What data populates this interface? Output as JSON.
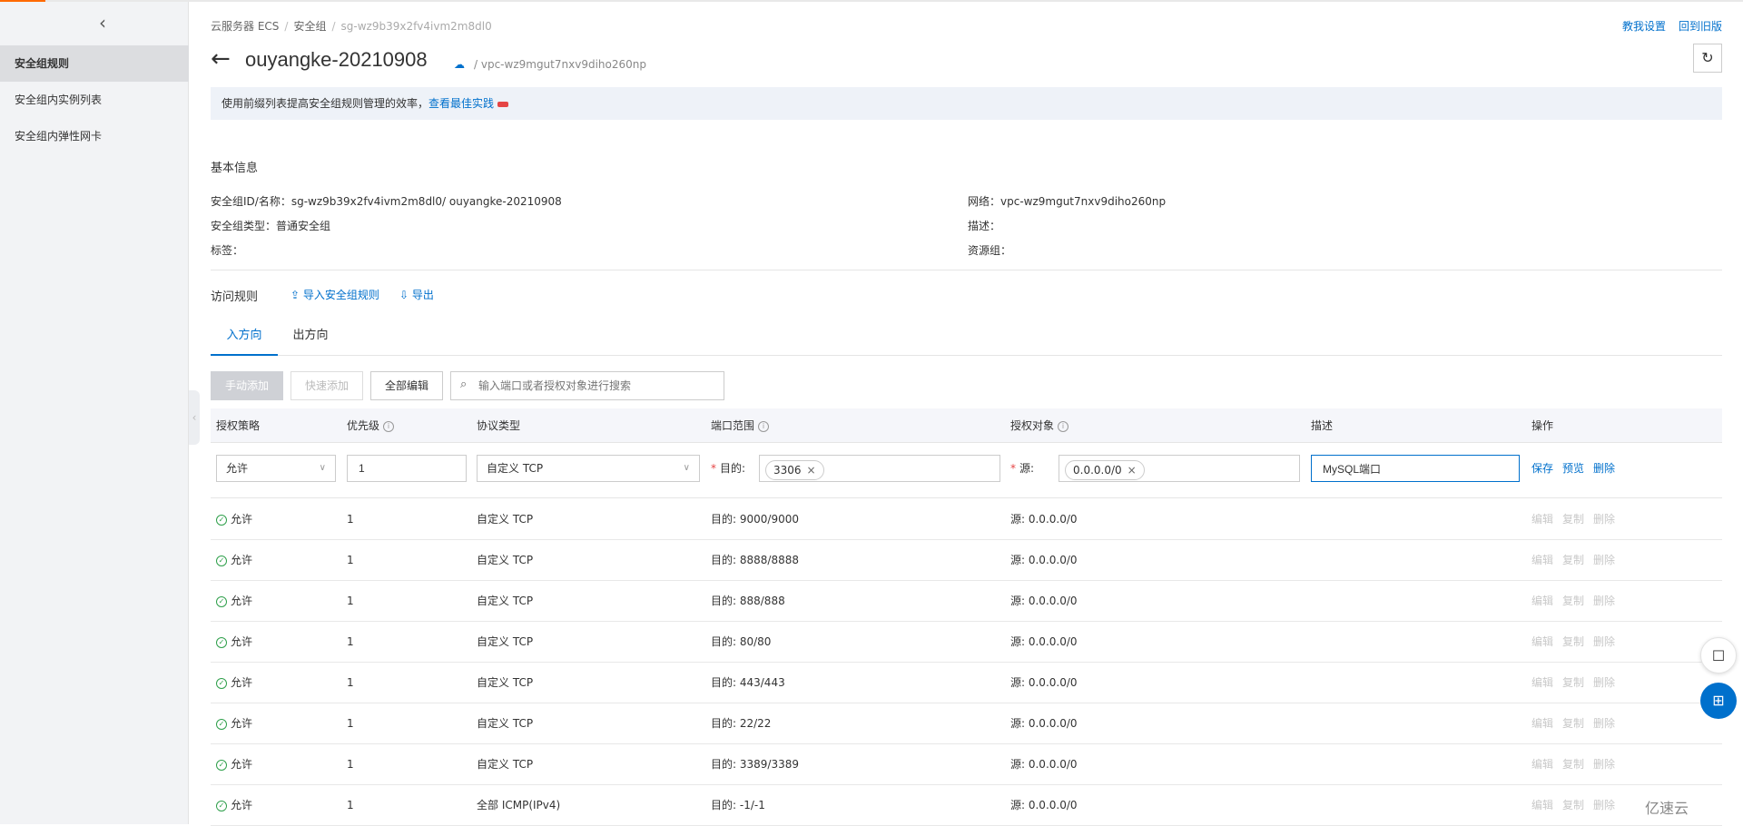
{
  "sidebar": {
    "items": [
      "安全组规则",
      "安全组内实例列表",
      "安全组内弹性网卡"
    ]
  },
  "breadcrumb": [
    "云服务器 ECS",
    "安全组",
    "sg-wz9b39x2fv4ivm2m8dl0"
  ],
  "top_links": {
    "feedback": "教我设置",
    "old_version": "回到旧版"
  },
  "header": {
    "title": "ouyangke-20210908",
    "vpc": "/ vpc-wz9mgut7nxv9diho260np"
  },
  "tip": {
    "text": "使用前缀列表提高安全组规则管理的效率，",
    "link": "查看最佳实践"
  },
  "basic_info": {
    "title": "基本信息",
    "id_name": "安全组ID/名称：sg-wz9b39x2fv4ivm2m8dl0/ ouyangke-20210908",
    "type": "安全组类型：普通安全组",
    "tags": "标签：",
    "network": "网络：vpc-wz9mgut7nxv9diho260np",
    "desc": "描述：",
    "resource_group": "资源组："
  },
  "rules": {
    "title": "访问规则",
    "import": "导入安全组规则",
    "export": "导出",
    "tabs": [
      "入方向",
      "出方向"
    ],
    "buttons": {
      "manual_add": "手动添加",
      "quick_add": "快速添加",
      "edit_all": "全部编辑"
    },
    "search_placeholder": "输入端口或者授权对象进行搜索",
    "columns": [
      "授权策略",
      "优先级",
      "协议类型",
      "端口范围",
      "授权对象",
      "描述",
      "操作"
    ],
    "edit_row": {
      "policy": "允许",
      "priority": "1",
      "protocol": "自定义 TCP",
      "dest_label": "目的:",
      "port_chip": "3306",
      "src_label": "源:",
      "src_chip": "0.0.0.0/0",
      "description": "MySQL端口",
      "actions": [
        "保存",
        "预览",
        "删除"
      ]
    },
    "rows": [
      {
        "policy": "允许",
        "priority": "1",
        "protocol": "自定义 TCP",
        "port": "目的: 9000/9000",
        "source": "源: 0.0.0.0/0"
      },
      {
        "policy": "允许",
        "priority": "1",
        "protocol": "自定义 TCP",
        "port": "目的: 8888/8888",
        "source": "源: 0.0.0.0/0"
      },
      {
        "policy": "允许",
        "priority": "1",
        "protocol": "自定义 TCP",
        "port": "目的: 888/888",
        "source": "源: 0.0.0.0/0"
      },
      {
        "policy": "允许",
        "priority": "1",
        "protocol": "自定义 TCP",
        "port": "目的: 80/80",
        "source": "源: 0.0.0.0/0"
      },
      {
        "policy": "允许",
        "priority": "1",
        "protocol": "自定义 TCP",
        "port": "目的: 443/443",
        "source": "源: 0.0.0.0/0"
      },
      {
        "policy": "允许",
        "priority": "1",
        "protocol": "自定义 TCP",
        "port": "目的: 22/22",
        "source": "源: 0.0.0.0/0"
      },
      {
        "policy": "允许",
        "priority": "1",
        "protocol": "自定义 TCP",
        "port": "目的: 3389/3389",
        "source": "源: 0.0.0.0/0"
      },
      {
        "policy": "允许",
        "priority": "1",
        "protocol": "全部 ICMP(IPv4)",
        "port": "目的: -1/-1",
        "source": "源: 0.0.0.0/0"
      }
    ],
    "row_actions": [
      "编辑",
      "复制",
      "删除"
    ]
  },
  "watermark": "亿速云",
  "colors": {
    "accent": "#0070cc",
    "brand": "#ff6a00",
    "ok": "#2e9f4a"
  }
}
